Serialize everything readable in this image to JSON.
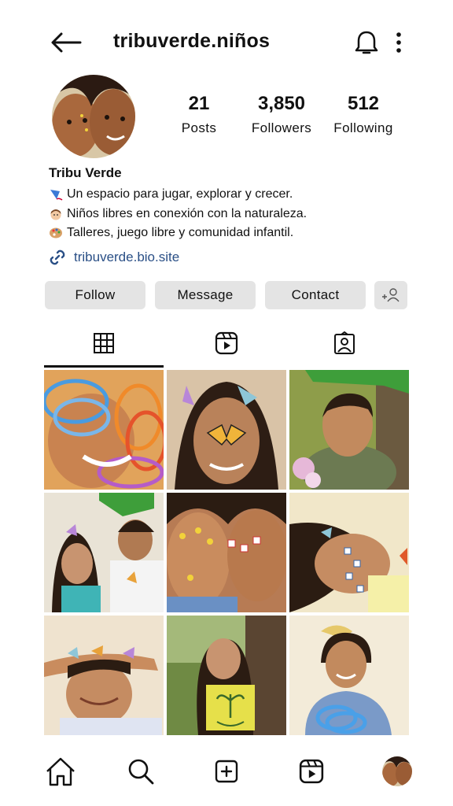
{
  "header": {
    "username": "tribuverde.niños",
    "icons": [
      "back-arrow-icon",
      "bell-icon",
      "more-vertical-icon"
    ]
  },
  "profile": {
    "stats": [
      {
        "value": "21",
        "label": "Posts"
      },
      {
        "value": "3,850",
        "label": "Followers"
      },
      {
        "value": "512",
        "label": "Following"
      }
    ],
    "name": "Tribu Verde",
    "bio_lines": [
      "Un espacio para jugar, explorar y crecer.",
      "Niños libres en conexión con la naturaleza.",
      "Talleres, juego libre y comunidad infantil."
    ],
    "bio_icons": [
      "kite-emoji",
      "boy-emoji",
      "palette-emoji"
    ],
    "link": "tribuverde.bio.site"
  },
  "actions": {
    "follow": "Follow",
    "message": "Message",
    "contact": "Contact"
  },
  "tabs": [
    "grid-icon",
    "reels-icon",
    "tagged-icon"
  ],
  "posts": [
    {
      "desc": "child with colorful slinky toy",
      "bg": "#e1a35b"
    },
    {
      "desc": "girl with butterfly on nose",
      "bg": "#d9c3a7"
    },
    {
      "desc": "boy under green paper roof",
      "bg": "#8e9d4a"
    },
    {
      "desc": "two kids with paper butterflies",
      "bg": "#e9e3d6"
    },
    {
      "desc": "two kids with face stickers",
      "bg": "#b77b54"
    },
    {
      "desc": "girl lying with letter stickers",
      "bg": "#f1e7c9"
    },
    {
      "desc": "boy with butterflies on arm",
      "bg": "#efe3cf"
    },
    {
      "desc": "girl holding plant drawing",
      "bg": "#6f8a44"
    },
    {
      "desc": "boy with slinky and bow",
      "bg": "#f3ebd9"
    }
  ],
  "bottom_nav": [
    "home-icon",
    "search-icon",
    "create-icon",
    "reels-icon",
    "profile-avatar"
  ],
  "colors": {
    "link": "#2a4f86",
    "button_bg": "#e4e4e4",
    "text": "#111111"
  }
}
